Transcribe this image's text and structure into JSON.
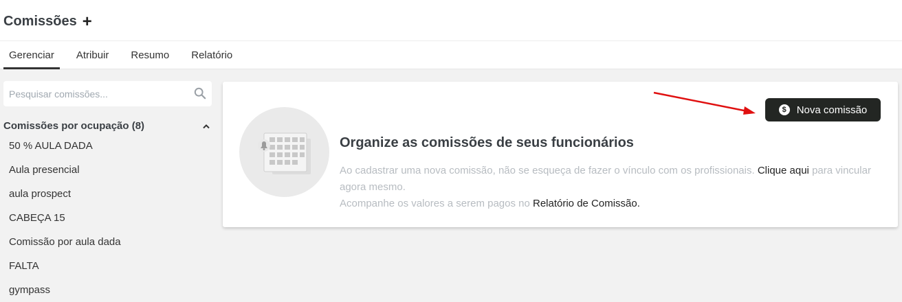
{
  "header": {
    "title": "Comissões",
    "add_label": "+"
  },
  "tabs": [
    {
      "label": "Gerenciar",
      "active": true
    },
    {
      "label": "Atribuir"
    },
    {
      "label": "Resumo"
    },
    {
      "label": "Relatório"
    }
  ],
  "sidebar": {
    "search_placeholder": "Pesquisar comissões...",
    "group_title": "Comissões por ocupação (8)",
    "items": [
      "50 % AULA DADA",
      "Aula presencial",
      "aula prospect",
      "CABEÇA 15",
      "Comissão por aula dada",
      "FALTA",
      "gympass"
    ]
  },
  "card": {
    "heading": "Organize as comissões de seus funcionários",
    "line1_text": "Ao cadastrar uma nova comissão, não se esqueça de fazer o vínculo com os profissionais.",
    "line1_link": "Clique aqui",
    "line1_after": "para vincular agora mesmo.",
    "line2_text": "Acompanhe os valores a serem pagos no",
    "line2_link": "Relatório de Comissão.",
    "button_label": "Nova comissão",
    "button_icon": "$"
  },
  "colors": {
    "button_bg": "#232623",
    "annotation_arrow": "#e01010"
  }
}
